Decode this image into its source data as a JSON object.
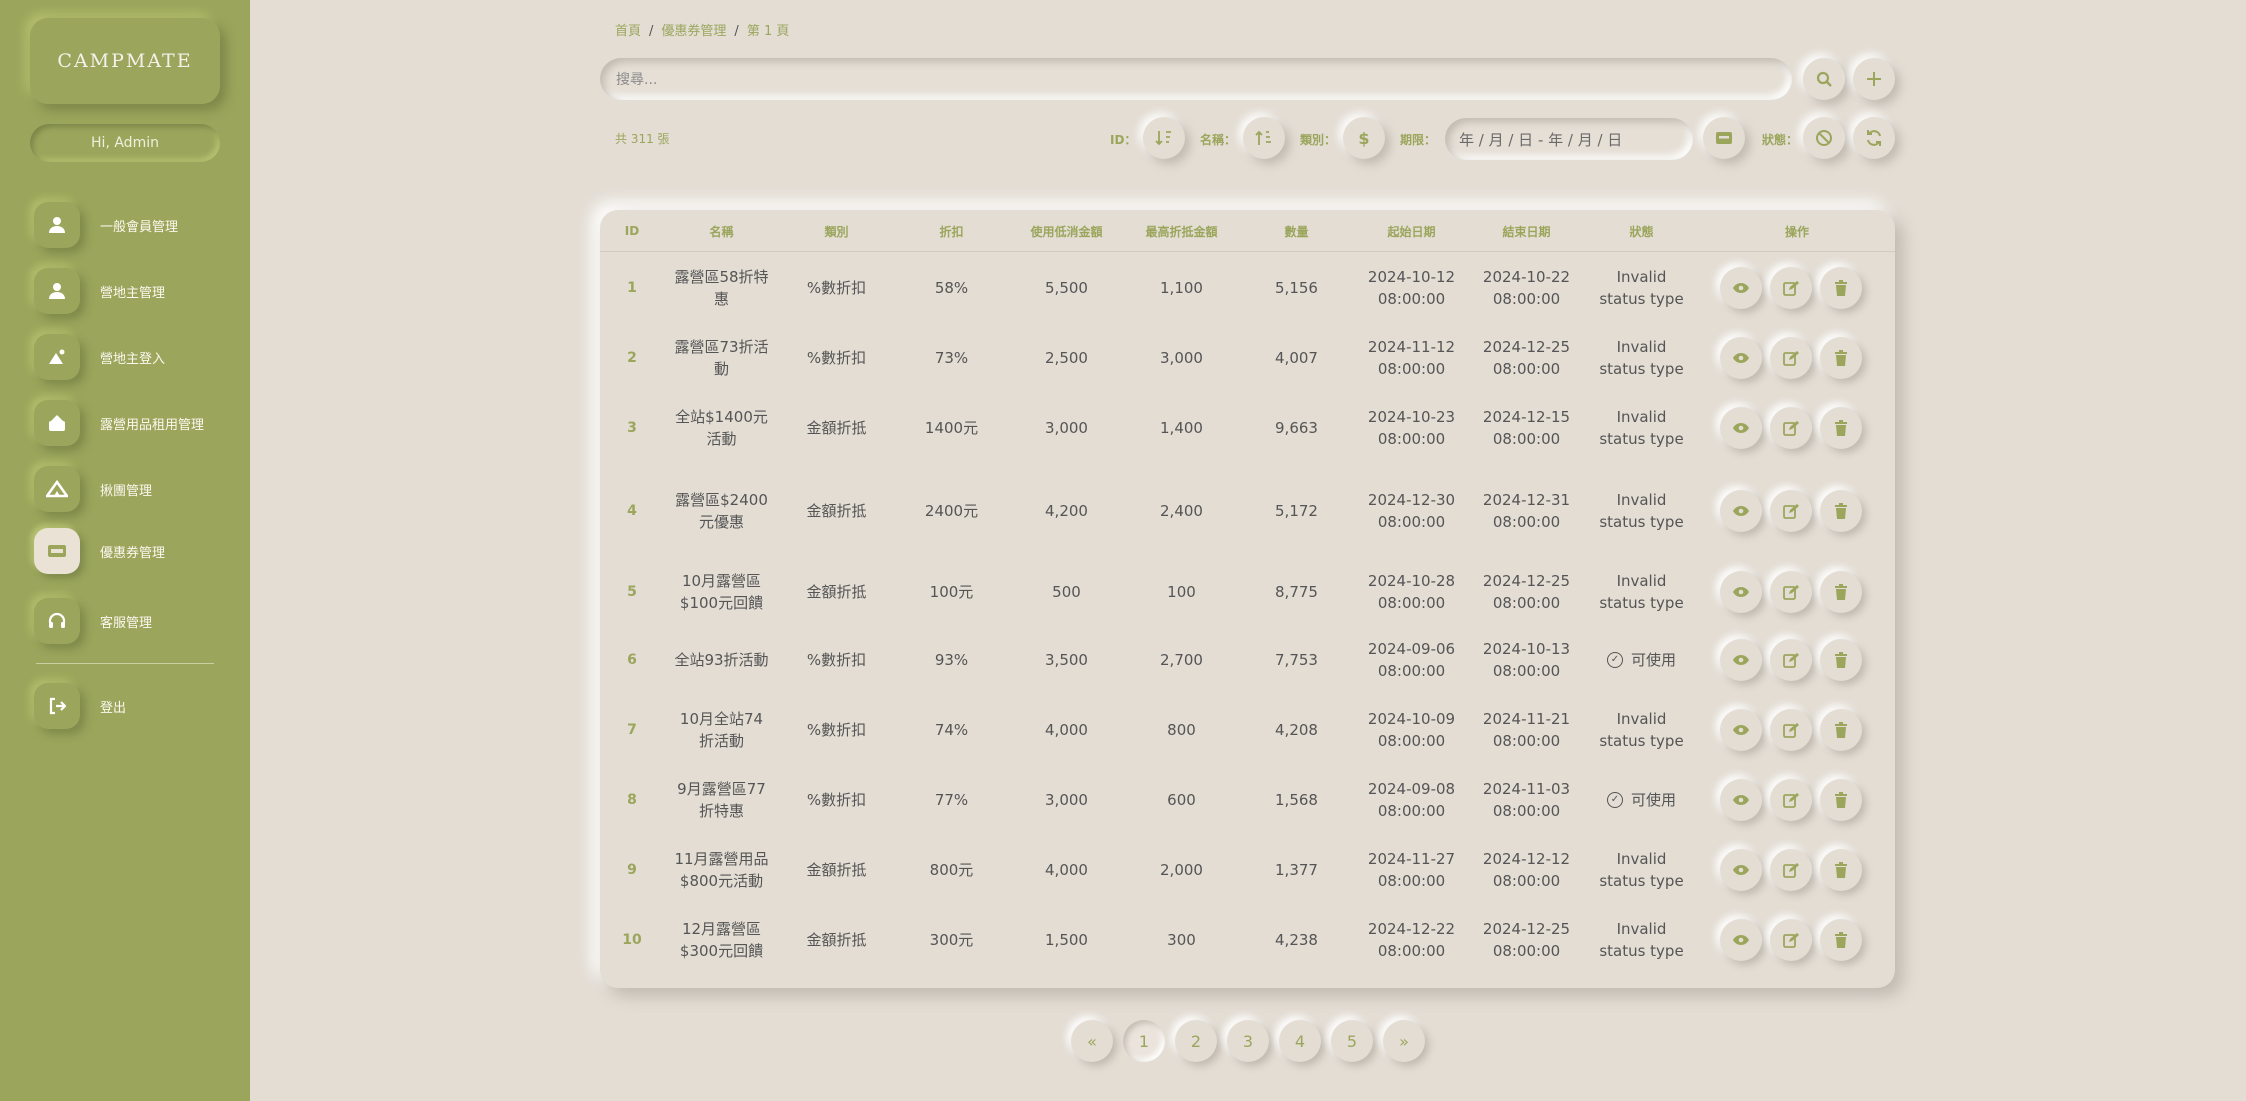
{
  "sidebar": {
    "logo": "CAMPMATE",
    "greeting": "Hi, Admin",
    "items": [
      {
        "label": "一般會員管理",
        "icon": "user-icon"
      },
      {
        "label": "營地主管理",
        "icon": "user-icon"
      },
      {
        "label": "營地主登入",
        "icon": "camp-login-icon"
      },
      {
        "label": "露營用品租用管理",
        "icon": "equipment-icon"
      },
      {
        "label": "揪團管理",
        "icon": "group-tent-icon"
      },
      {
        "label": "優惠券管理",
        "icon": "ticket-icon",
        "active": true
      },
      {
        "label": "客服管理",
        "icon": "headset-icon"
      }
    ],
    "logout": "登出"
  },
  "breadcrumb": [
    "首頁",
    "優惠券管理",
    "第 1 頁"
  ],
  "search": {
    "placeholder": "搜尋..."
  },
  "toolbar": {
    "total": "共 311 張",
    "id_label": "ID：",
    "name_label": "名稱：",
    "type_label": "類別：",
    "period_label": "期限：",
    "date_placeholder": "年 / 月 / 日 - 年 / 月 / 日",
    "status_label": "狀態："
  },
  "table": {
    "headers": [
      "ID",
      "名稱",
      "類別",
      "折扣",
      "使用低消金額",
      "最高折抵金額",
      "數量",
      "起始日期",
      "結束日期",
      "狀態",
      "操作"
    ],
    "rows": [
      {
        "id": "1",
        "name": "露營區58折特惠",
        "type": "%數折扣",
        "discount": "58%",
        "min": "5,500",
        "max": "1,100",
        "qty": "5,156",
        "start_date": "2024-10-12",
        "start_time": "08:00:00",
        "end_date": "2024-10-22",
        "end_time": "08:00:00",
        "status": "Invalid status type",
        "valid": false
      },
      {
        "id": "2",
        "name": "露營區73折活動",
        "type": "%數折扣",
        "discount": "73%",
        "min": "2,500",
        "max": "3,000",
        "qty": "4,007",
        "start_date": "2024-11-12",
        "start_time": "08:00:00",
        "end_date": "2024-12-25",
        "end_time": "08:00:00",
        "status": "Invalid status type",
        "valid": false
      },
      {
        "id": "3",
        "name": "全站$1400元活動",
        "type": "金額折抵",
        "discount": "1400元",
        "min": "3,000",
        "max": "1,400",
        "qty": "9,663",
        "start_date": "2024-10-23",
        "start_time": "08:00:00",
        "end_date": "2024-12-15",
        "end_time": "08:00:00",
        "status": "Invalid status type",
        "valid": false
      },
      {
        "id": "4",
        "name": "露營區$2400元優惠",
        "type": "金額折抵",
        "discount": "2400元",
        "min": "4,200",
        "max": "2,400",
        "qty": "5,172",
        "start_date": "2024-12-30",
        "start_time": "08:00:00",
        "end_date": "2024-12-31",
        "end_time": "08:00:00",
        "status": "Invalid status type",
        "valid": false
      },
      {
        "id": "5",
        "name": "10月露營區$100元回饋",
        "type": "金額折抵",
        "discount": "100元",
        "min": "500",
        "max": "100",
        "qty": "8,775",
        "start_date": "2024-10-28",
        "start_time": "08:00:00",
        "end_date": "2024-12-25",
        "end_time": "08:00:00",
        "status": "Invalid status type",
        "valid": false
      },
      {
        "id": "6",
        "name": "全站93折活動",
        "type": "%數折扣",
        "discount": "93%",
        "min": "3,500",
        "max": "2,700",
        "qty": "7,753",
        "start_date": "2024-09-06",
        "start_time": "08:00:00",
        "end_date": "2024-10-13",
        "end_time": "08:00:00",
        "status": "可使用",
        "valid": true
      },
      {
        "id": "7",
        "name": "10月全站74折活動",
        "type": "%數折扣",
        "discount": "74%",
        "min": "4,000",
        "max": "800",
        "qty": "4,208",
        "start_date": "2024-10-09",
        "start_time": "08:00:00",
        "end_date": "2024-11-21",
        "end_time": "08:00:00",
        "status": "Invalid status type",
        "valid": false
      },
      {
        "id": "8",
        "name": "9月露營區77折特惠",
        "type": "%數折扣",
        "discount": "77%",
        "min": "3,000",
        "max": "600",
        "qty": "1,568",
        "start_date": "2024-09-08",
        "start_time": "08:00:00",
        "end_date": "2024-11-03",
        "end_time": "08:00:00",
        "status": "可使用",
        "valid": true
      },
      {
        "id": "9",
        "name": "11月露營用品$800元活動",
        "type": "金額折抵",
        "discount": "800元",
        "min": "4,000",
        "max": "2,000",
        "qty": "1,377",
        "start_date": "2024-11-27",
        "start_time": "08:00:00",
        "end_date": "2024-12-12",
        "end_time": "08:00:00",
        "status": "Invalid status type",
        "valid": false
      },
      {
        "id": "10",
        "name": "12月露營區$300元回饋",
        "type": "金額折抵",
        "discount": "300元",
        "min": "1,500",
        "max": "300",
        "qty": "4,238",
        "start_date": "2024-12-22",
        "start_time": "08:00:00",
        "end_date": "2024-12-25",
        "end_time": "08:00:00",
        "status": "Invalid status type",
        "valid": false
      }
    ]
  },
  "pagination": {
    "prev": "«",
    "pages": [
      "1",
      "2",
      "3",
      "4",
      "5"
    ],
    "current": "1",
    "next": "»"
  },
  "colors": {
    "accent": "#9ba65c",
    "background": "#e3ddd4"
  }
}
